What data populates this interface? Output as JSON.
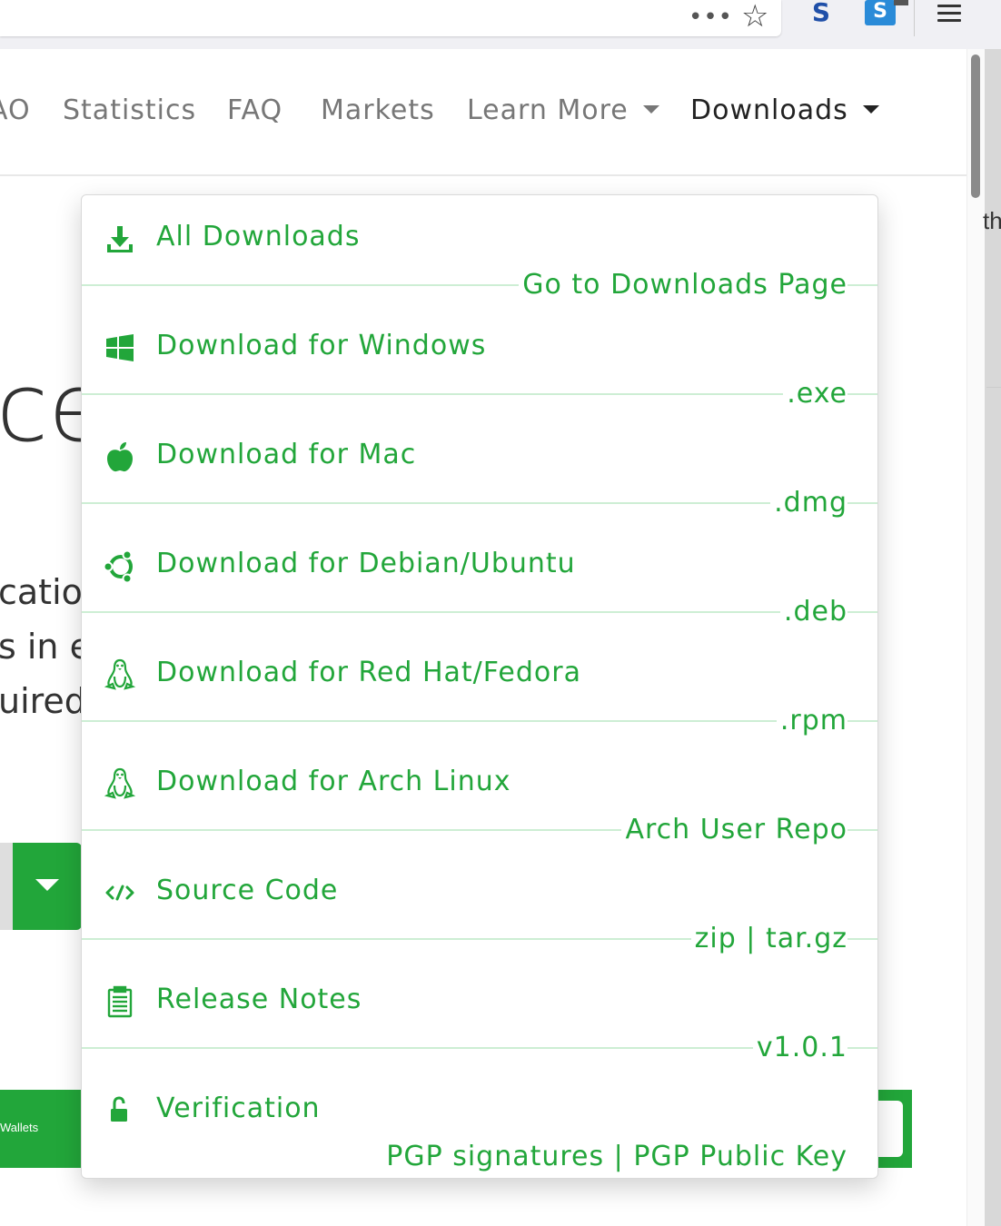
{
  "browser": {
    "more_icon": "•••",
    "star_icon": "☆",
    "ext1_label": "S",
    "ext2_label": "S",
    "menu_icon": "hamburger-icon"
  },
  "nav": {
    "items": [
      "AO",
      "Statistics",
      "FAQ",
      "Markets",
      "Learn More",
      "Downloads"
    ]
  },
  "background": {
    "hero_text": "ce",
    "line1": "catio",
    "line2": "s in e",
    "line3": "uired",
    "side_text": "th",
    "wallets_label": "Wallets"
  },
  "dropdown": {
    "accent_color": "#22a63a",
    "items": [
      {
        "title": "All Downloads",
        "sub": "Go to Downloads Page",
        "icon": "download-icon"
      },
      {
        "title": "Download for Windows",
        "sub": ".exe",
        "icon": "windows-icon"
      },
      {
        "title": "Download for Mac",
        "sub": ".dmg",
        "icon": "apple-icon"
      },
      {
        "title": "Download for Debian/Ubuntu",
        "sub": ".deb",
        "icon": "ubuntu-icon"
      },
      {
        "title": "Download for Red Hat/Fedora",
        "sub": ".rpm",
        "icon": "linux-icon"
      },
      {
        "title": "Download for Arch Linux",
        "sub": "Arch User Repo",
        "icon": "linux-icon"
      },
      {
        "title": "Source Code",
        "sub": "zip | tar.gz",
        "icon": "code-icon"
      },
      {
        "title": "Release Notes",
        "sub": "v1.0.1",
        "icon": "clipboard-icon"
      },
      {
        "title": "Verification",
        "sub": "PGP signatures | PGP Public Key",
        "icon": "unlock-icon"
      }
    ]
  }
}
